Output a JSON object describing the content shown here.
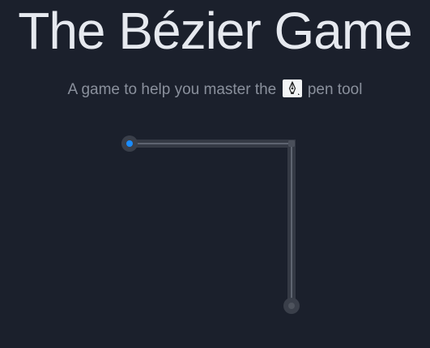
{
  "header": {
    "title": "The Bézier Game",
    "subtitle_before": "A game to help you master the",
    "subtitle_after": "pen tool",
    "pen_icon": "pen-tool-icon"
  },
  "colors": {
    "background": "#1b202c",
    "title": "#e6e9ef",
    "subtitle": "#8a909c",
    "path_track": "#3a3f4a",
    "path_line": "#5a5f6a",
    "active_anchor": "#1a8cff",
    "inactive_anchor": "#4a4f5a"
  }
}
